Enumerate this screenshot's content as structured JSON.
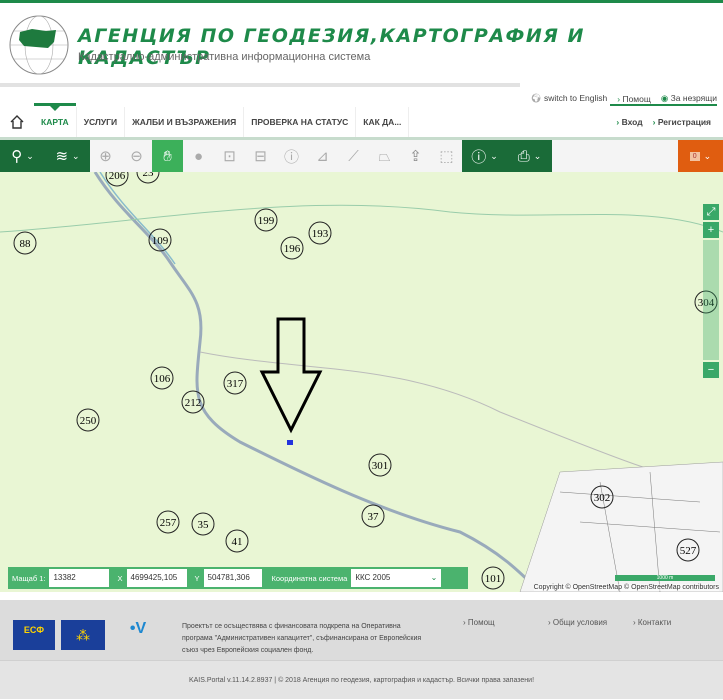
{
  "header": {
    "title": "АГЕНЦИЯ ПО ГЕОДЕЗИЯ,КАРТОГРАФИЯ И КАДАСТЪР",
    "subtitle": "Кадастрално-административна информационна система"
  },
  "toplinks": {
    "english": "switch to English",
    "help": "Помощ",
    "visually_impaired": "За незрящи"
  },
  "nav": {
    "items": [
      "КАРТА",
      "УСЛУГИ",
      "ЖАЛБИ И ВЪЗРАЖЕНИЯ",
      "ПРОВЕРКА НА СТАТУС",
      "КАК ДА..."
    ],
    "login": "Вход",
    "register": "Регистрация"
  },
  "toolbar": {
    "badge": "0"
  },
  "map": {
    "parcel_labels": [
      "206",
      "23",
      "88",
      "109",
      "199",
      "196",
      "193",
      "304",
      "106",
      "317",
      "212",
      "250",
      "301",
      "302",
      "257",
      "35",
      "37",
      "41",
      "527",
      "101"
    ],
    "scale_label": "Мащаб 1:",
    "scale": "13382",
    "x_label": "X",
    "x": "4699425,105",
    "y_label": "Y",
    "y": "504781,306",
    "crs_label": "Координатна система",
    "crs": "ККС 2005",
    "scalebar": "1000 m",
    "copyright": "Copyright © OpenStreetMap © OpenStreetMap contributors"
  },
  "footer": {
    "text": "Проектът се осъществява с финансовата подкрепа на Оперативна програма \"Административен капацитет\", съфинансирана от Европейския съюз чрез Европейския социален фонд.",
    "links": [
      "Помощ",
      "Общи условия",
      "Контакти"
    ],
    "logo_esf": "ЕСФ",
    "copyright": "KAIS.Portal v.11.14.2.8937 | © 2018 Агенция по геодезия, картография и кадастър. Всички права запазени!"
  }
}
